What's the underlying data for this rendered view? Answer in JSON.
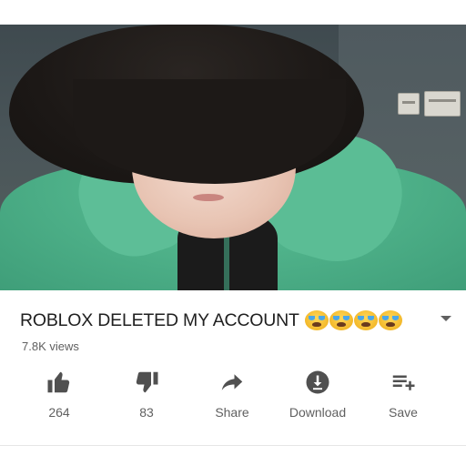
{
  "video": {
    "title": "ROBLOX DELETED MY ACCOUNT",
    "title_emoji": "😭😭😭😭",
    "views": "7.8K views"
  },
  "actions": {
    "like": {
      "label": "264",
      "icon": "thumbs-up-icon"
    },
    "dislike": {
      "label": "83",
      "icon": "thumbs-down-icon"
    },
    "share": {
      "label": "Share",
      "icon": "share-arrow-icon"
    },
    "download": {
      "label": "Download",
      "icon": "download-icon"
    },
    "save": {
      "label": "Save",
      "icon": "playlist-add-icon"
    }
  },
  "colors": {
    "text_primary": "#202020",
    "text_secondary": "#606060",
    "jacket_green": "#4fb28a"
  }
}
